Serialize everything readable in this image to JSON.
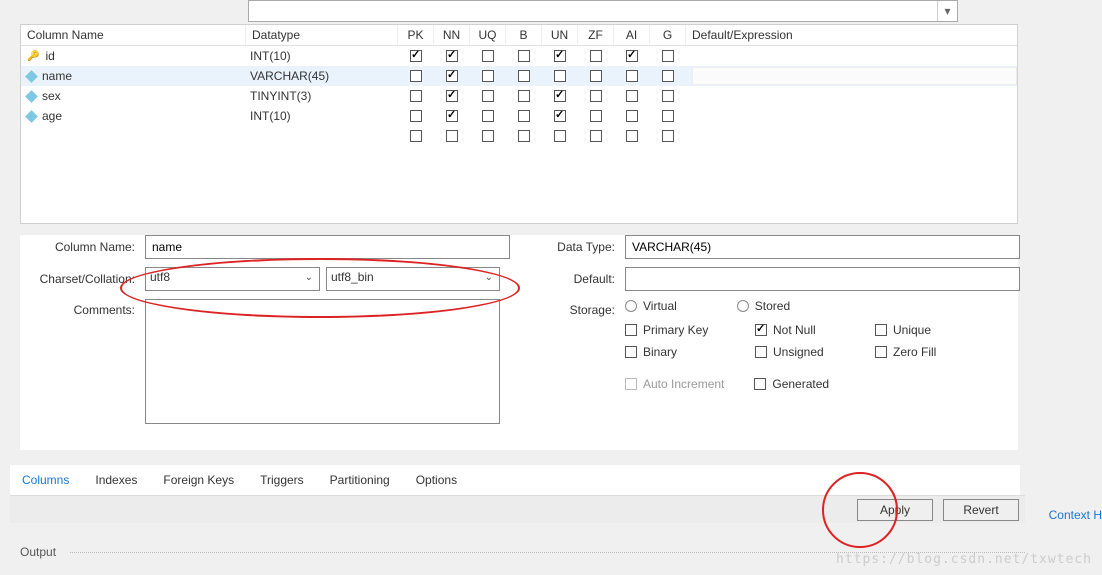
{
  "top_dropdown_value": "",
  "grid": {
    "headers": {
      "name": "Column Name",
      "type": "Datatype",
      "pk": "PK",
      "nn": "NN",
      "uq": "UQ",
      "b": "B",
      "un": "UN",
      "zf": "ZF",
      "ai": "AI",
      "g": "G",
      "default": "Default/Expression"
    },
    "rows": [
      {
        "icon": "key",
        "name": "id",
        "type": "INT(10)",
        "pk": true,
        "nn": true,
        "uq": false,
        "b": false,
        "un": true,
        "zf": false,
        "ai": true,
        "g": false,
        "default": ""
      },
      {
        "icon": "blue",
        "name": "name",
        "type": "VARCHAR(45)",
        "pk": false,
        "nn": true,
        "uq": false,
        "b": false,
        "un": false,
        "zf": false,
        "ai": false,
        "g": false,
        "default": "",
        "selected": true
      },
      {
        "icon": "blue",
        "name": "sex",
        "type": "TINYINT(3)",
        "pk": false,
        "nn": true,
        "uq": false,
        "b": false,
        "un": true,
        "zf": false,
        "ai": false,
        "g": false,
        "default": ""
      },
      {
        "icon": "blue",
        "name": "age",
        "type": "INT(10)",
        "pk": false,
        "nn": true,
        "uq": false,
        "b": false,
        "un": true,
        "zf": false,
        "ai": false,
        "g": false,
        "default": ""
      }
    ]
  },
  "detail": {
    "labels": {
      "column_name": "Column Name:",
      "charset": "Charset/Collation:",
      "comments": "Comments:",
      "data_type": "Data Type:",
      "default": "Default:",
      "storage": "Storage:"
    },
    "column_name_value": "name",
    "charset_value": "utf8",
    "collation_value": "utf8_bin",
    "comments_value": "",
    "data_type_value": "VARCHAR(45)",
    "default_value": "",
    "storage": {
      "virtual": "Virtual",
      "stored": "Stored",
      "primary_key": "Primary Key",
      "not_null": "Not Null",
      "unique": "Unique",
      "binary": "Binary",
      "unsigned": "Unsigned",
      "zero_fill": "Zero Fill",
      "auto_increment": "Auto Increment",
      "generated": "Generated",
      "checked": {
        "not_null": true
      }
    }
  },
  "tabs": {
    "columns": "Columns",
    "indexes": "Indexes",
    "foreign_keys": "Foreign Keys",
    "triggers": "Triggers",
    "partitioning": "Partitioning",
    "options": "Options",
    "active": "columns"
  },
  "buttons": {
    "apply": "Apply",
    "revert": "Revert"
  },
  "output_label": "Output",
  "context_link": "Context H",
  "watermark": "https://blog.csdn.net/txwtech"
}
